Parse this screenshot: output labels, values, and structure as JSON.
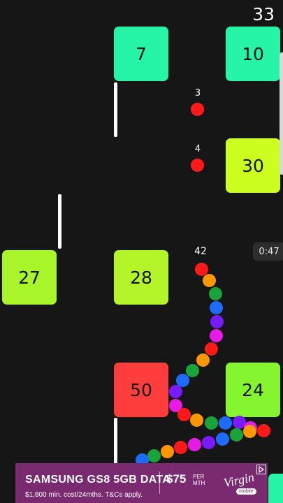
{
  "hud": {
    "score": "33",
    "timer": "0:47",
    "snake_length": "42"
  },
  "blocks": [
    {
      "id": "block-7",
      "value": "7",
      "color": "#26f5a8"
    },
    {
      "id": "block-10",
      "value": "10",
      "color": "#26f5a8"
    },
    {
      "id": "block-30",
      "value": "30",
      "color": "#ccff1f"
    },
    {
      "id": "block-27",
      "value": "27",
      "color": "#a8f52a"
    },
    {
      "id": "block-28",
      "value": "28",
      "color": "#b4f52a"
    },
    {
      "id": "block-50",
      "value": "50",
      "color": "#ff3d3d"
    },
    {
      "id": "block-24",
      "value": "24",
      "color": "#84f52f"
    }
  ],
  "food": [
    {
      "value": "3",
      "color": "#ff1a1a"
    },
    {
      "value": "4",
      "color": "#ff1a1a"
    }
  ],
  "snake_palette": [
    "#ff1a1a",
    "#ff9800",
    "#1aa33a",
    "#1e6bff",
    "#7a1aff",
    "#e81ae8"
  ],
  "ad": {
    "headline": "SAMSUNG GS8 5GB DATA",
    "sub": "$1,800 min. cost/24mths. T&Cs apply.",
    "price": "$75",
    "per": "PER MTH",
    "logo": "Virgin",
    "logo_sub": "mobile",
    "bg_color": "#7a2a6f"
  }
}
